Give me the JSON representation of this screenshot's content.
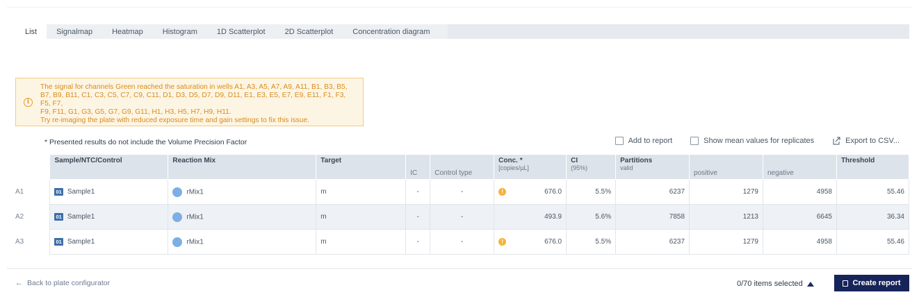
{
  "tabs": [
    "List",
    "Signalmap",
    "Heatmap",
    "Histogram",
    "1D Scatterplot",
    "2D Scatterplot",
    "Concentration diagram"
  ],
  "active_tab": "List",
  "warning": {
    "line1": "The signal for channels Green reached the saturation in wells A1, A3, A5, A7, A9, A11, B1, B3, B5,",
    "line2": "B7, B9, B11, C1, C3, C5, C7, C9, C11, D1, D3, D5, D7, D9, D11, E1, E3, E5, E7, E9, E11, F1, F3, F5, F7,",
    "line3": "F9, F11, G1, G3, G5, G7, G9, G11, H1, H3, H5, H7, H9, H11.",
    "line4": "Try re-imaging the plate with reduced exposure time and gain settings to fix this issue.",
    "icon": "info-icon"
  },
  "note": "* Presented results do not include the Volume Precision Factor",
  "options": {
    "add_to_report": "Add to report",
    "show_mean": "Show mean values for replicates",
    "export": "Export to CSV..."
  },
  "table": {
    "headers": {
      "sample": "Sample/NTC/Control",
      "reaction_mix": "Reaction Mix",
      "target": "Target",
      "ic": "IC",
      "control_type": "Control type",
      "conc": "Conc. *",
      "conc_unit": "[copies/µL]",
      "ci": "CI",
      "ci_unit": "(95%)",
      "partitions": "Partitions",
      "valid": "valid",
      "positive": "positive",
      "negative": "negative",
      "threshold": "Threshold"
    },
    "rows": [
      {
        "well": "A1",
        "badge": "01",
        "sample": "Sample1",
        "mix": "rMix1",
        "target": "m",
        "ic": "-",
        "control_type": "-",
        "warn": "!",
        "conc": "676.0",
        "ci": "5.5%",
        "valid": "6237",
        "positive": "1279",
        "negative": "4958",
        "threshold": "55.46"
      },
      {
        "well": "A2",
        "badge": "01",
        "sample": "Sample1",
        "mix": "rMix1",
        "target": "m",
        "ic": "-",
        "control_type": "-",
        "warn": "",
        "conc": "493.9",
        "ci": "5.6%",
        "valid": "7858",
        "positive": "1213",
        "negative": "6645",
        "threshold": "36.34"
      },
      {
        "well": "A3",
        "badge": "01",
        "sample": "Sample1",
        "mix": "rMix1",
        "target": "m",
        "ic": "-",
        "control_type": "-",
        "warn": "!",
        "conc": "676.0",
        "ci": "5.5%",
        "valid": "6237",
        "positive": "1279",
        "negative": "4958",
        "threshold": "55.46"
      }
    ]
  },
  "footer": {
    "back_arrow": "←",
    "back": "Back to plate configurator",
    "selected": "0/70 items selected",
    "create_report": "Create report"
  },
  "colors": {
    "primary": "#17245a",
    "warning_text": "#d88b1a",
    "warning_bg": "#fdf5e4",
    "badge": "#3d6ea8",
    "mix_dot": "#7cb0e4",
    "conc_warn": "#f2b43a"
  }
}
